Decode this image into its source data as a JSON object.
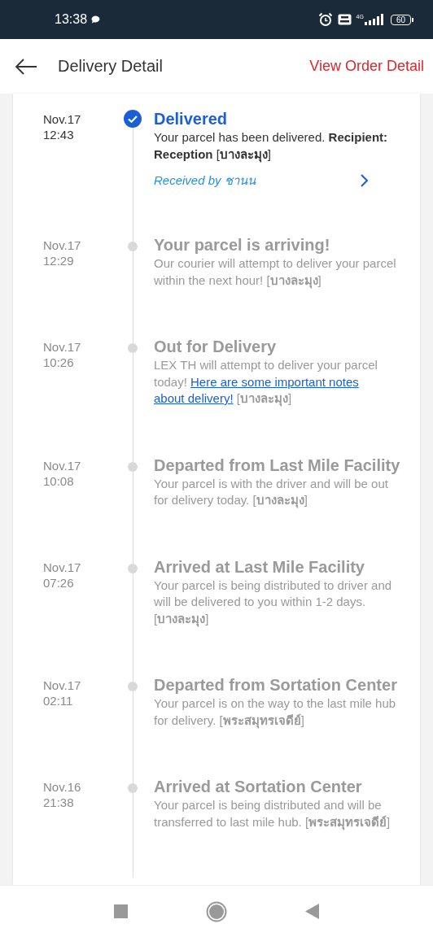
{
  "status_bar": {
    "time": "13:38",
    "network": "4G",
    "battery": "60"
  },
  "header": {
    "title": "Delivery Detail",
    "action": "View Order Detail"
  },
  "events": [
    {
      "date": "Nov.17",
      "time": "12:43",
      "title": "Delivered",
      "current": true,
      "desc": "Your parcel has been delivered. **Recipient: Reception** [**บางละมุง**]",
      "received_by": "Received by ชานน"
    },
    {
      "date": "Nov.17",
      "time": "12:29",
      "title": "Your parcel is arriving!",
      "current": false,
      "desc": "Our courier will attempt to deliver your parcel within the next hour! [**บางละมุง**]"
    },
    {
      "date": "Nov.17",
      "time": "10:26",
      "title": "Out for Delivery",
      "current": false,
      "desc": "LEX TH will attempt to deliver your parcel today!",
      "link_lines": [
        "Here are some important notes",
        "about delivery!"
      ],
      "desc_after": "[**บางละมุง**]"
    },
    {
      "date": "Nov.17",
      "time": "10:08",
      "title": "Departed from Last Mile Facility",
      "current": false,
      "desc": "Your parcel is with the driver and will be out for delivery today. [**บางละมุง**]"
    },
    {
      "date": "Nov.17",
      "time": "07:26",
      "title": "Arrived at Last Mile Facility",
      "current": false,
      "desc": "Your parcel is being distributed to driver and will be delivered to you within 1-2 days. [**บางละมุง**]"
    },
    {
      "date": "Nov.17",
      "time": "02:11",
      "title": "Departed from Sortation Center",
      "current": false,
      "desc": "Your parcel is on the way to the last mile hub for delivery. [**พระสมุทรเจดีย์**]"
    },
    {
      "date": "Nov.16",
      "time": "21:38",
      "title": "Arrived at Sortation Center",
      "current": false,
      "desc": "Your parcel is being distributed and will be transferred to last mile hub. [**พระสมุทรเจดีย์**]"
    }
  ]
}
